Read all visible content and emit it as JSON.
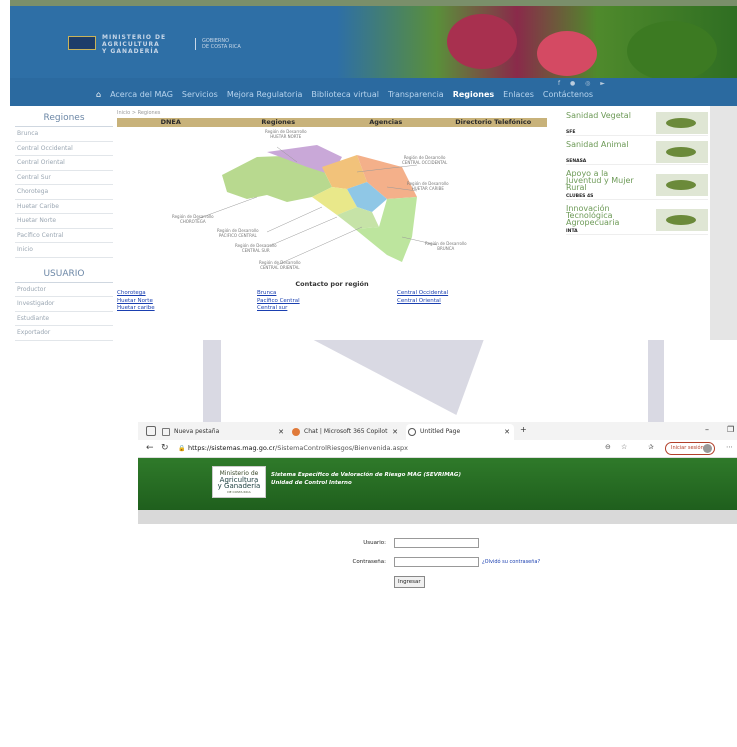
{
  "colors": {
    "header_blue": "#2e6fa6",
    "nav_blue": "#2b6aa0",
    "table_header": "#c8b27a",
    "app_green": "#2f7a2a",
    "link_blue": "#1a3fb0",
    "promo_green": "#6d9a57"
  },
  "site": {
    "ministry_name": [
      "MINISTERIO DE",
      "AGRICULTURA",
      "Y GANADERÍA"
    ],
    "gov_name": [
      "GOBIERNO",
      "DE COSTA RICA"
    ],
    "nav": {
      "home_icon": "home-icon",
      "items": [
        "Acerca del MAG",
        "Servicios",
        "Mejora Regulatoria",
        "Biblioteca virtual",
        "Transparencia",
        "Regiones",
        "Enlaces",
        "Contáctenos"
      ],
      "active": "Regiones"
    },
    "left": {
      "regions_title": "Regiones",
      "regions": [
        "Brunca",
        "Central Occidental",
        "Central Oriental",
        "Central Sur",
        "Chorotega",
        "Huetar Caribe",
        "Huetar Norte",
        "Pacífico Central",
        "Inicio"
      ],
      "user_title": "USUARIO",
      "user_items": [
        "Productor",
        "Investigador",
        "Estudiante",
        "Exportador"
      ]
    },
    "breadcrumb": "Inicio > Regiones",
    "table_headers": [
      "DNEA",
      "Regiones",
      "Agencias",
      "Directorio Telefónico"
    ],
    "map_labels": [
      [
        "Región de Desarrollo",
        "HUETAR NORTE"
      ],
      [
        "Región de Desarrollo",
        "CENTRAL OCCIDENTAL"
      ],
      [
        "Región de Desarrollo",
        "HUETAR CARIBE"
      ],
      [
        "Región de Desarrollo",
        "CHOROTEGA"
      ],
      [
        "Región de Desarrollo",
        "PACIFICO CENTRAL"
      ],
      [
        "Región de Desarrollo",
        "CENTRAL SUR"
      ],
      [
        "Región de Desarrollo",
        "CENTRAL ORIENTAL"
      ],
      [
        "Región de Desarrollo",
        "BRUNCA"
      ]
    ],
    "contact_title": "Contacto por región",
    "contact_links": [
      "Chorotega",
      "Brunca",
      "Central Occidental",
      "Huetar Norte",
      "Pacífico Central",
      "Central Oriental",
      "Huetar caribe",
      "Central sur"
    ],
    "promos": [
      {
        "title": "Sanidad Vegetal",
        "sub": "SFE"
      },
      {
        "title": "Sanidad Animal",
        "sub": "SENASA"
      },
      {
        "title": "Apoyo a la Juventud y Mujer Rural",
        "sub": "CLUBES 4S"
      },
      {
        "title": "Innovación Tecnológica Agropecuaria",
        "sub": "INTA"
      }
    ]
  },
  "browser": {
    "tabs": [
      {
        "label": "Nueva pestaña"
      },
      {
        "label": "Chat | Microsoft 365 Copilot"
      },
      {
        "label": "Untitled Page"
      }
    ],
    "new_tab": "+",
    "url_host": "https://sistemas.mag.go.cr",
    "url_path": "/SistemaControlRiesgos/Bienvenida.aspx",
    "signin_label": "Iniciar sesión",
    "app_logo": [
      "Ministerio de",
      "Agricultura",
      "y Ganadería",
      "DE COSTA RICA"
    ],
    "app_title": "Sistema Específico de Valoración de Riesgo MAG (SEVRIMAG)",
    "app_subtitle": "Unidad de Control Interno",
    "login": {
      "user_label": "Usuario:",
      "password_label": "Contraseña:",
      "forgot": "¿Olvidó su contraseña?",
      "submit": "Ingresar"
    }
  }
}
